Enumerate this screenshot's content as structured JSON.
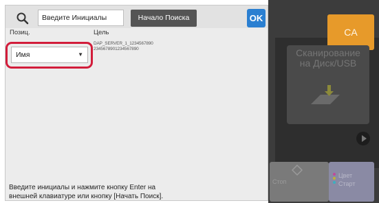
{
  "search": {
    "placeholder": "Введите Инициалы",
    "start_label": "Начало Поиска",
    "ok_label": "OK"
  },
  "columns": {
    "position": "Позиц.",
    "target": "Цель"
  },
  "select": {
    "value": "Имя"
  },
  "target": {
    "line1": "DAP_SERVER_1_1234567890",
    "line2": "2345678901234567890"
  },
  "instructions": {
    "line1": "Введите инициалы и нажмите кнопку Enter на",
    "line2": "внешней клавиатуре или кнопку [Начать Поиск]."
  },
  "right_panel": {
    "ca_label": "CA",
    "scan_line1": "Сканирование",
    "scan_line2": "на Диск/USB",
    "stop_label": "Стоп",
    "color_line1": "Цвет",
    "color_line2": "Старт"
  },
  "colors": {
    "accent": "#2a7fd1",
    "highlight": "#d21c3a",
    "ca": "#e79a2a"
  }
}
